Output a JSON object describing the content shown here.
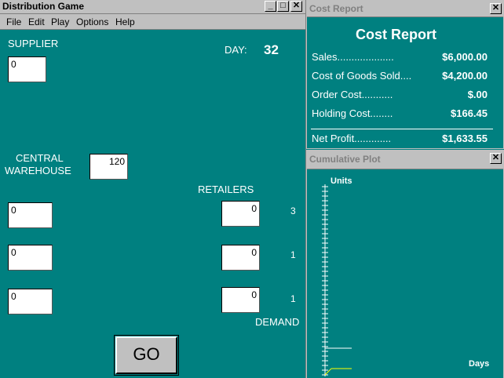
{
  "main_window": {
    "title": "Distribution Game",
    "menu": [
      "File",
      "Edit",
      "Play",
      "Options",
      "Help"
    ],
    "supplier_label": "SUPPLIER",
    "supplier_value": "0",
    "day_label": "DAY:",
    "day_value": "32",
    "central_warehouse_label_1": "CENTRAL",
    "central_warehouse_label_2": "WAREHOUSE",
    "central_warehouse_value": "120",
    "retailers_label": "RETAILERS",
    "left_boxes": [
      "0",
      "0",
      "0"
    ],
    "retailer_boxes": [
      "0",
      "0",
      "0"
    ],
    "demands": [
      "3",
      "1",
      "1"
    ],
    "demand_label": "DEMAND",
    "go_label": "GO"
  },
  "cost_report": {
    "window_title": "Cost Report",
    "heading": "Cost Report",
    "rows": [
      {
        "label": "Sales....................",
        "value": "$6,000.00"
      },
      {
        "label": "Cost of Goods Sold....",
        "value": "$4,200.00"
      },
      {
        "label": "Order Cost...........",
        "value": "$.00"
      },
      {
        "label": "Holding Cost........",
        "value": "$166.45"
      }
    ],
    "net_profit": {
      "label": "Net Profit.............",
      "value": "$1,633.55"
    }
  },
  "cumulative_plot": {
    "window_title": "Cumulative Plot",
    "y_label": "Units",
    "x_label": "Days",
    "line_colors": [
      "#ffffff",
      "#ffff00"
    ]
  }
}
